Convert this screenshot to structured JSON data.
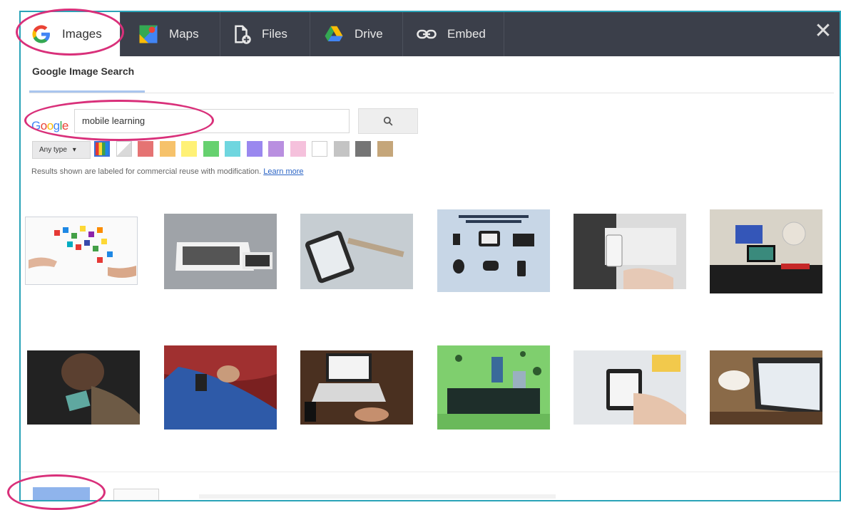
{
  "tabs": [
    {
      "label": "Images",
      "icon": "google-g-icon",
      "active": true
    },
    {
      "label": "Maps",
      "icon": "maps-icon",
      "active": false
    },
    {
      "label": "Files",
      "icon": "file-upload-icon",
      "active": false
    },
    {
      "label": "Drive",
      "icon": "google-drive-icon",
      "active": false
    },
    {
      "label": "Embed",
      "icon": "link-icon",
      "active": false
    }
  ],
  "subtab": {
    "label": "Google Image Search"
  },
  "search": {
    "logo_text": "Google",
    "value": "mobile learning",
    "button_icon": "search-icon"
  },
  "filters": {
    "type_label": "Any type",
    "colors": [
      "multicolor",
      "transparent",
      "#e57373",
      "#f6c26b",
      "#fff176",
      "#66d16f",
      "#6fd6df",
      "#9a88ef",
      "#b98fe0",
      "#f5c1dc",
      "#ffffff",
      "#c4c4c4",
      "#757575",
      "#c5a67a"
    ]
  },
  "notice": {
    "text": "Results shown are labeled for commercial reuse with modification.",
    "link": "Learn more"
  },
  "results": [
    {
      "name": "colorful-app-icons-hand"
    },
    {
      "name": "tablet-phone-devices"
    },
    {
      "name": "smartphone-text-blocks"
    },
    {
      "name": "mobile-devices-diagram"
    },
    {
      "name": "tablet-in-hands"
    },
    {
      "name": "desk-with-monitor"
    },
    {
      "name": "child-with-phone"
    },
    {
      "name": "person-on-phone-lying"
    },
    {
      "name": "laptop-and-phone-desk"
    },
    {
      "name": "people-on-green-sofa"
    },
    {
      "name": "hand-holding-tablet"
    },
    {
      "name": "laptop-coffee"
    }
  ],
  "colors": {
    "tabbar": "#3b3f4a",
    "frame_border": "#2aa3b8",
    "annotation": "#d9307a",
    "link": "#2a64c5",
    "primary_button": "#8fb4ec"
  }
}
